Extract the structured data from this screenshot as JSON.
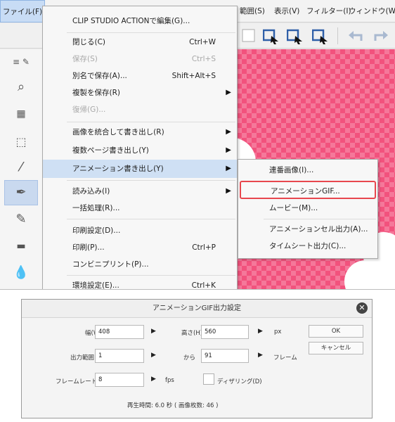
{
  "menubar": {
    "file": "ファイル(F)",
    "selection": "範囲(S)",
    "view": "表示(V)",
    "filter": "フィルター(I)",
    "window": "ウィンドウ(W)"
  },
  "file_menu": {
    "items": [
      {
        "label": "CLIP STUDIO ACTIONで編集(G)...",
        "shortcut": "",
        "submenu": false,
        "disabled": false
      },
      {
        "label": "閉じる(C)",
        "shortcut": "Ctrl+W",
        "submenu": false,
        "disabled": false
      },
      {
        "label": "保存(S)",
        "shortcut": "Ctrl+S",
        "submenu": false,
        "disabled": true
      },
      {
        "label": "別名で保存(A)...",
        "shortcut": "Shift+Alt+S",
        "submenu": false,
        "disabled": false
      },
      {
        "label": "複製を保存(R)",
        "shortcut": "",
        "submenu": true,
        "disabled": false
      },
      {
        "label": "復帰(G)...",
        "shortcut": "",
        "submenu": false,
        "disabled": true
      },
      {
        "label": "画像を統合して書き出し(R)",
        "shortcut": "",
        "submenu": true,
        "disabled": false
      },
      {
        "label": "複数ページ書き出し(Y)",
        "shortcut": "",
        "submenu": true,
        "disabled": false
      },
      {
        "label": "アニメーション書き出し(Y)",
        "shortcut": "",
        "submenu": true,
        "disabled": false
      },
      {
        "label": "読み込み(I)",
        "shortcut": "",
        "submenu": true,
        "disabled": false
      },
      {
        "label": "一括処理(R)...",
        "shortcut": "",
        "submenu": false,
        "disabled": false
      },
      {
        "label": "印刷設定(D)...",
        "shortcut": "",
        "submenu": false,
        "disabled": false
      },
      {
        "label": "印刷(P)...",
        "shortcut": "Ctrl+P",
        "submenu": false,
        "disabled": false
      },
      {
        "label": "コンビニプリント(P)...",
        "shortcut": "",
        "submenu": false,
        "disabled": false
      },
      {
        "label": "環境設定(E)...",
        "shortcut": "Ctrl+K",
        "submenu": false,
        "disabled": false
      }
    ]
  },
  "animation_submenu": {
    "items": [
      {
        "label": "連番画像(I)..."
      },
      {
        "label": "アニメーションGIF..."
      },
      {
        "label": "ムービー(M)..."
      },
      {
        "label": "アニメーションセル出力(A)..."
      },
      {
        "label": "タイムシート出力(C)..."
      }
    ]
  },
  "dialog": {
    "title": "アニメーションGIF出力設定",
    "width_label": "幅(W):",
    "width_value": "408",
    "height_label": "高さ(H):",
    "height_value": "560",
    "size_unit": "px",
    "range_label": "出力範囲",
    "range_from": "1",
    "range_to_label": "から",
    "range_to": "91",
    "range_unit": "フレーム",
    "framerate_label": "フレームレート(F):",
    "framerate_value": "8",
    "framerate_unit": "fps",
    "dither_label": "ディザリング(D)",
    "playback_info": "再生時間: 6.0 秒 ( 画像枚数: 46 )",
    "ok_label": "OK",
    "cancel_label": "キャンセル"
  },
  "colors": {
    "canvas_pink": "#f2527d",
    "highlight": "#cfe0f4",
    "callout_red": "#e8474e"
  },
  "icons": [
    "close-icon",
    "undo-icon",
    "redo-icon",
    "zoom-icon",
    "pen-icon",
    "eyedropper-icon",
    "brush-icon",
    "fill-icon",
    "selection-icon"
  ]
}
